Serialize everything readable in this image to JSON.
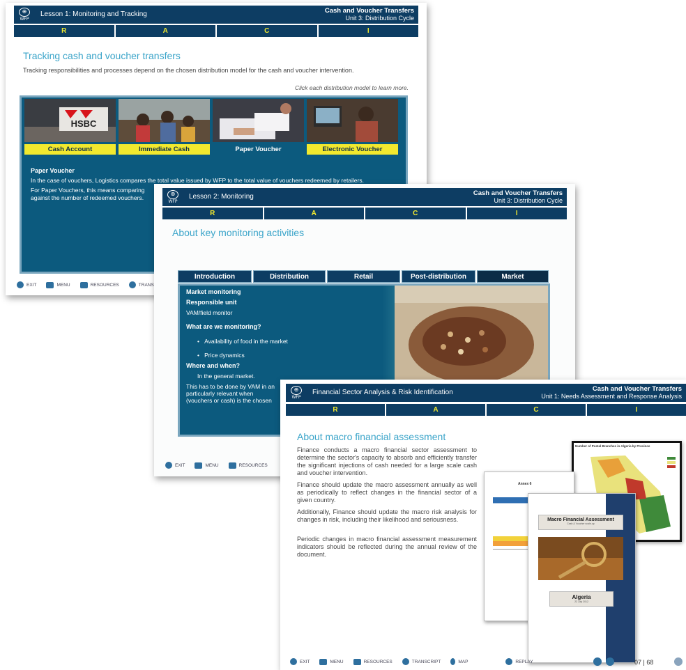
{
  "slide1": {
    "lesson": "Lesson 1: Monitoring and Tracking",
    "course": "Cash and Voucher Transfers",
    "unit": "Unit 3: Distribution Cycle",
    "race": [
      "R",
      "A",
      "C",
      "I"
    ],
    "heading": "Tracking cash and voucher transfers",
    "intro": "Tracking responsibilities and processes depend on the chosen distribution model for the cash and voucher intervention.",
    "instruction": "Click each distribution model to learn more.",
    "tiles": [
      "Cash Account",
      "Immediate Cash",
      "Paper Voucher",
      "Electronic Voucher"
    ],
    "hsbc": "HSBC",
    "panel_title": "Paper Voucher",
    "panel_p1": "In the case of vouchers, Logistics compares the total value issued by WFP to the total value of vouchers redeemed by retailers.",
    "panel_p2a": "For Paper Vouchers, this means comparing",
    "panel_p2b": "against the number of redeemed vouchers.",
    "footer": [
      "EXIT",
      "MENU",
      "RESOURCES",
      "TRANSCRIPT"
    ]
  },
  "slide2": {
    "lesson": "Lesson 2: Monitoring",
    "course": "Cash and Voucher Transfers",
    "unit": "Unit 3: Distribution Cycle",
    "race": [
      "R",
      "A",
      "C",
      "I"
    ],
    "heading": "About key monitoring activities",
    "tabs": [
      "Introduction",
      "Distribution",
      "Retail",
      "Post-distribution",
      "Market"
    ],
    "mm": "Market monitoring",
    "ru": "Responsible unit",
    "ru_val": "VAM/field monitor",
    "wm": "What are we monitoring?",
    "b1": "Availability of food in the market",
    "b2": "Price dynamics",
    "ww": "Where and when?",
    "ww_val": "In the general market.",
    "p1": "This has to be done by VAM in an",
    "p2": "particularly relevant when",
    "p3": "(vouchers or cash) is the chosen",
    "footer": [
      "EXIT",
      "MENU",
      "RESOURCES"
    ]
  },
  "slide3": {
    "lesson": "Financial Sector Analysis & Risk Identification",
    "course": "Cash and Voucher Transfers",
    "unit": "Unit 1: Needs Assessment and Response Analysis",
    "race": [
      "R",
      "A",
      "C",
      "I"
    ],
    "heading": "About macro financial assessment",
    "paras": [
      "Finance conducts a macro financial sector assessment to determine the sector's capacity to absorb and efficiently transfer the significant injections of cash needed for a large scale cash and voucher intervention.",
      "Finance should update the macro assessment annually as well as periodically to reflect changes in the financial sector of a given country.",
      "Additionally, Finance should update the macro risk analysis for changes in risk, including their likelihood and seriousness.",
      "Periodic changes in macro financial assessment measurement indicators should be reflected during the annual review of the document."
    ],
    "doc_title": "Macro Financial Assessment",
    "doc_sub": "Cash & Voucher scale-up",
    "doc_country": "Algeria",
    "doc_date": "22 July 2012",
    "map_title": "Number of Postal Branches in Algeria by Province",
    "annex": "Annex 6",
    "footer": [
      "EXIT",
      "MENU",
      "RESOURCES",
      "TRANSCRIPT",
      "MAP",
      "REPLAY"
    ],
    "page": "07 | 68"
  },
  "colors": {
    "navy": "#0d3d63",
    "teal": "#0c5a7e",
    "yellow": "#f2e92e",
    "heading": "#3aa4c9"
  }
}
